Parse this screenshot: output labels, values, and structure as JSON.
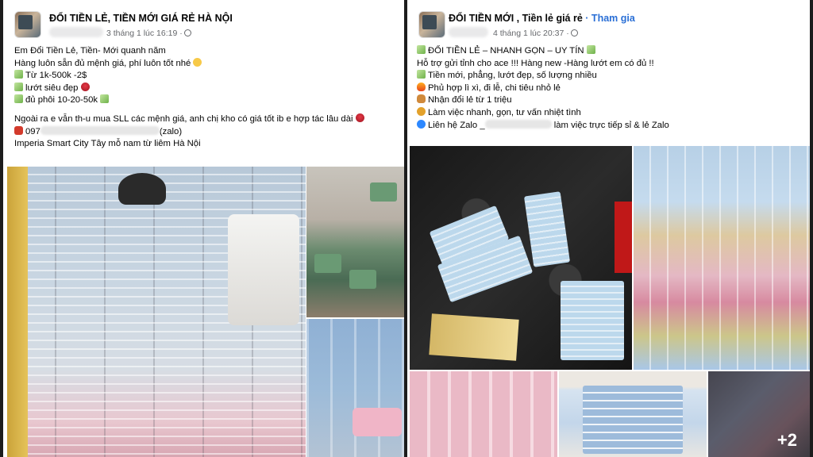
{
  "posts": [
    {
      "group_name": "ĐỔI TIỀN LẺ, TIỀN MỚI GIÁ RẺ HÀ NỘI",
      "timestamp": "3 tháng 1 lúc 16:19 ·",
      "lines": [
        "Em Đổi Tiền Lẻ, Tiền- Mới quanh năm",
        "Hàng luôn sẵn đủ mệnh giá, phí luôn tốt nhé",
        "Từ 1k-500k -2$",
        "lướt siêu đẹp",
        "đủ phôi 10-20-50k",
        "Ngoài ra e vẫn th-u mua SLL các mệnh giá, anh chị kho có giá tốt ib e hợp tác lâu dài",
        "097",
        "(zalo)",
        "Imperia Smart City Tây mỗ nam từ liêm Hà Nội"
      ]
    },
    {
      "group_name": "ĐỔI TIỀN MỚI , Tiền lẻ giá rẻ",
      "join_label": "· Tham gia",
      "timestamp": "4 tháng 1 lúc 20:37 ·",
      "lines": [
        "ĐỔI TIỀN LẺ – NHANH GỌN – UY TÍN",
        "Hỗ trợ gửi tỉnh cho ace !!! Hàng new -Hàng lướt em có đủ !!",
        "Tiền mới, phẳng, lướt đẹp, số lượng nhiều",
        "Phủ hợp lì xì, đi lễ, chi tiêu nhỏ lẻ",
        "Nhận đổi lẻ từ 1 triệu",
        "Làm việc nhanh, gọn, tư vấn nhiệt tình",
        "Liên hệ Zalo _",
        "làm việc trực tiếp sỉ & lẻ Zalo"
      ],
      "more_photos": "+2"
    }
  ]
}
